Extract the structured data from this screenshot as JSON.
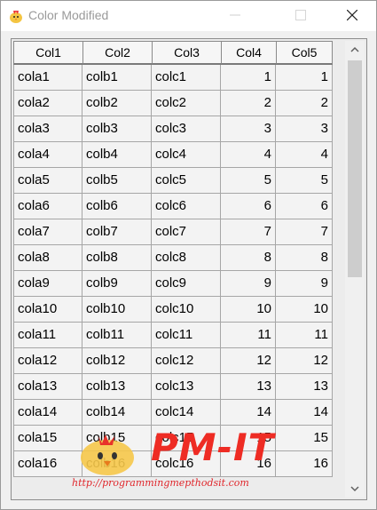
{
  "window": {
    "title": "Color Modified"
  },
  "grid": {
    "columns": [
      "Col1",
      "Col2",
      "Col3",
      "Col4",
      "Col5"
    ],
    "rows": [
      [
        "cola1",
        "colb1",
        "colc1",
        "1",
        "1"
      ],
      [
        "cola2",
        "colb2",
        "colc2",
        "2",
        "2"
      ],
      [
        "cola3",
        "colb3",
        "colc3",
        "3",
        "3"
      ],
      [
        "cola4",
        "colb4",
        "colc4",
        "4",
        "4"
      ],
      [
        "cola5",
        "colb5",
        "colc5",
        "5",
        "5"
      ],
      [
        "cola6",
        "colb6",
        "colc6",
        "6",
        "6"
      ],
      [
        "cola7",
        "colb7",
        "colc7",
        "7",
        "7"
      ],
      [
        "cola8",
        "colb8",
        "colc8",
        "8",
        "8"
      ],
      [
        "cola9",
        "colb9",
        "colc9",
        "9",
        "9"
      ],
      [
        "cola10",
        "colb10",
        "colc10",
        "10",
        "10"
      ],
      [
        "cola11",
        "colb11",
        "colc11",
        "11",
        "11"
      ],
      [
        "cola12",
        "colb12",
        "colc12",
        "12",
        "12"
      ],
      [
        "cola13",
        "colb13",
        "colc13",
        "13",
        "13"
      ],
      [
        "cola14",
        "colb14",
        "colc14",
        "14",
        "14"
      ],
      [
        "cola15",
        "colb15",
        "colc15",
        "15",
        "15"
      ],
      [
        "cola16",
        "colb16",
        "colc16",
        "16",
        "16"
      ]
    ]
  },
  "watermark": {
    "brand": "PM-IT",
    "url": "http://programmingmepthodsit.com"
  },
  "colors": {
    "brand_red": "#ee2c24",
    "title_gray": "#9a9a9a"
  }
}
